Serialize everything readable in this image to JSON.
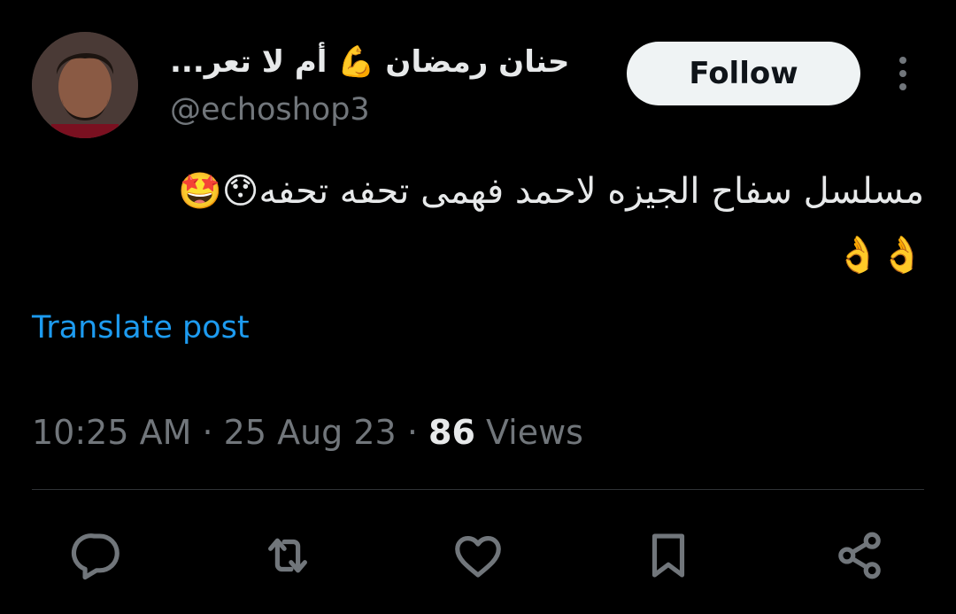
{
  "author": {
    "display_name": "حنان رمضان 💪 أم لا تعر...",
    "handle": "@echoshop3",
    "avatar_icon": "avatar-photo"
  },
  "follow_label": "Follow",
  "more_icon": "more-vertical-icon",
  "post": {
    "line1": "مسلسل سفاح الجيزه لاحمد فهمى تحفه تحفه😯🤩",
    "line2": "👌👌"
  },
  "translate_label": "Translate post",
  "meta": {
    "time": "10:25 AM",
    "sep1": "·",
    "date": "25 Aug 23",
    "sep2": "·",
    "views_count": "86",
    "views_label": "Views"
  },
  "actions": {
    "reply_icon": "reply-icon",
    "repost_icon": "repost-icon",
    "like_icon": "like-icon",
    "bookmark_icon": "bookmark-icon",
    "share_icon": "share-icon"
  },
  "colors": {
    "background": "#000000",
    "text_primary": "#e7e9ea",
    "text_secondary": "#71767b",
    "link": "#1d9bf0",
    "divider": "#2f3336",
    "follow_bg": "#eff3f4"
  }
}
